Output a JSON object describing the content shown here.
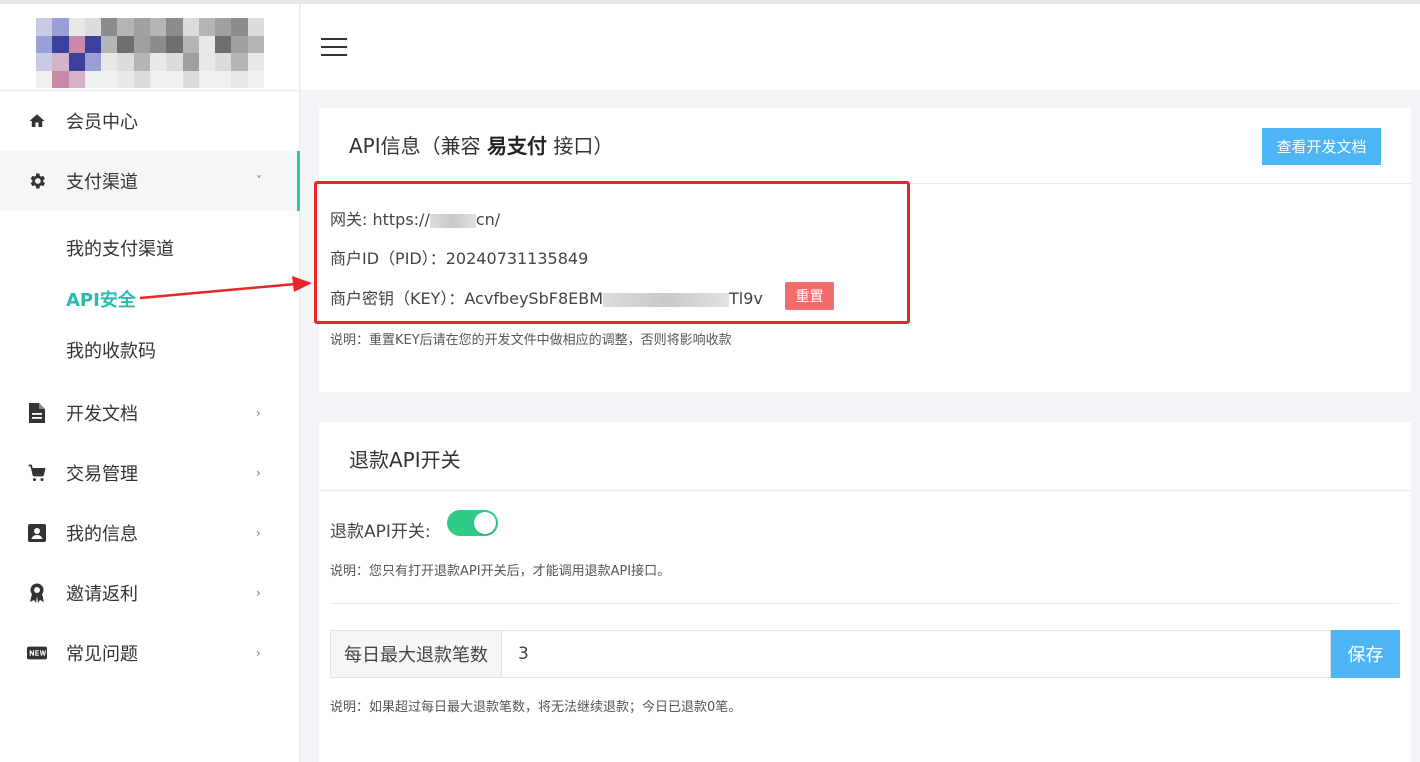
{
  "sidebar": {
    "items": [
      {
        "label": "会员中心",
        "icon": "home-icon",
        "has_children": false
      },
      {
        "label": "支付渠道",
        "icon": "gear-icon",
        "has_children": true,
        "expanded": true
      },
      {
        "label": "开发文档",
        "icon": "document-icon",
        "has_children": true
      },
      {
        "label": "交易管理",
        "icon": "cart-icon",
        "has_children": true
      },
      {
        "label": "我的信息",
        "icon": "contact-card-icon",
        "has_children": true
      },
      {
        "label": "邀请返利",
        "icon": "award-ribbon-icon",
        "has_children": true
      },
      {
        "label": "常见问题",
        "icon": "new-badge-icon",
        "has_children": true
      }
    ],
    "sub_items": [
      {
        "label": "我的支付渠道"
      },
      {
        "label": "API安全",
        "current": true
      },
      {
        "label": "我的收款码"
      }
    ],
    "chevron_down": "˅",
    "chevron_right": "›"
  },
  "api_card": {
    "title_prefix": "API信息（兼容 ",
    "title_bold": "易支付",
    "title_suffix": " 接口）",
    "doc_button": "查看开发文档",
    "gateway_label": "网关: ",
    "gateway_value_start": "https://",
    "gateway_value_end": "cn/",
    "pid_label": "商户ID（PID）：",
    "pid_value": "20240731135849",
    "key_label": "商户密钥（KEY）：",
    "key_value_start": "AcvfbeySbF8EBM",
    "key_value_end": "Tl9v",
    "reset_button": "重置",
    "note": "说明：重置KEY后请在您的开发文件中做相应的调整，否则将影响收款"
  },
  "refund_card": {
    "title": "退款API开关",
    "toggle_label": "退款API开关:",
    "toggle_on": true,
    "toggle_note": "说明：您只有打开退款API开关后，才能调用退款API接口。",
    "limit_label": "每日最大退款笔数",
    "limit_value": "3",
    "save_button": "保存",
    "limit_note": "说明：如果超过每日最大退款笔数，将无法继续退款；今日已退款0笔。"
  },
  "colors": {
    "accent": "#2bbbad",
    "primary_button": "#4cb5f5",
    "danger_button": "#f26c6c",
    "toggle_on": "#2ecc87",
    "annotation_red": "#e8262a"
  }
}
